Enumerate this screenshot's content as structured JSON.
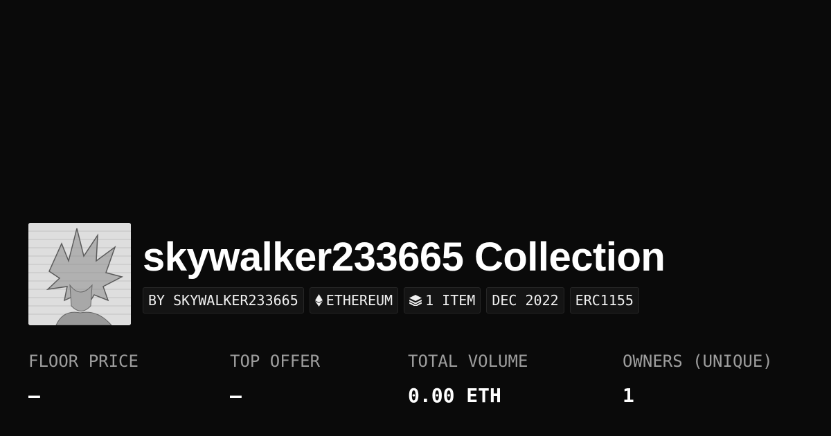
{
  "collection": {
    "title": "skywalker233665 Collection",
    "avatar_icon": "sketch-portrait-image"
  },
  "tags": [
    {
      "label": "BY SKYWALKER233665",
      "icon": ""
    },
    {
      "label": "ETHEREUM",
      "icon": "ethereum-icon"
    },
    {
      "label": "1 ITEM",
      "icon": "layers-icon"
    },
    {
      "label": "DEC 2022",
      "icon": ""
    },
    {
      "label": "ERC1155",
      "icon": ""
    }
  ],
  "stats": [
    {
      "label": "FLOOR PRICE",
      "value": "—"
    },
    {
      "label": "TOP OFFER",
      "value": "—"
    },
    {
      "label": "TOTAL VOLUME",
      "value": "0.00 ETH"
    },
    {
      "label": "OWNERS (UNIQUE)",
      "value": "1"
    }
  ],
  "colors": {
    "background": "#0a0a0a",
    "text": "#ffffff",
    "muted": "#9e9e9e",
    "tag_bg": "#141414"
  }
}
